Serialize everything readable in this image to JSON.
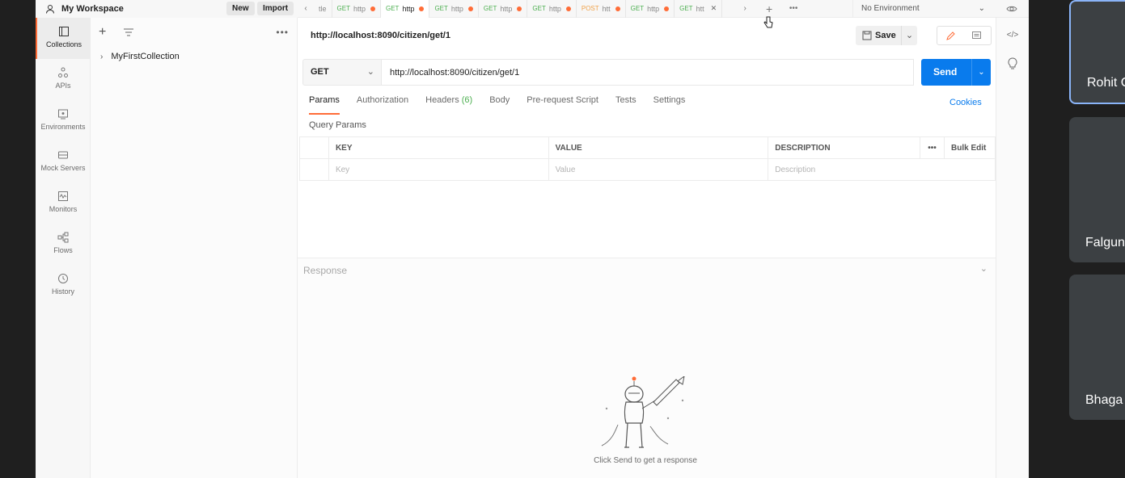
{
  "workspace": {
    "title": "My Workspace",
    "new_label": "New",
    "import_label": "Import"
  },
  "rail": [
    {
      "label": "Collections",
      "icon": "collections-icon"
    },
    {
      "label": "APIs",
      "icon": "apis-icon"
    },
    {
      "label": "Environments",
      "icon": "environments-icon"
    },
    {
      "label": "Mock Servers",
      "icon": "mock-servers-icon"
    },
    {
      "label": "Monitors",
      "icon": "monitors-icon"
    },
    {
      "label": "Flows",
      "icon": "flows-icon"
    },
    {
      "label": "History",
      "icon": "history-icon"
    }
  ],
  "sidebar": {
    "collection_name": "MyFirstCollection"
  },
  "tabs": [
    {
      "method": "",
      "label": "tle"
    },
    {
      "method": "GET",
      "label": "http"
    },
    {
      "method": "GET",
      "label": "http"
    },
    {
      "method": "GET",
      "label": "http"
    },
    {
      "method": "GET",
      "label": "http"
    },
    {
      "method": "GET",
      "label": "http"
    },
    {
      "method": "POST",
      "label": "htt"
    },
    {
      "method": "GET",
      "label": "http"
    },
    {
      "method": "GET",
      "label": "htt"
    }
  ],
  "environment": {
    "selected": "No Environment"
  },
  "request": {
    "name": "http://localhost:8090/citizen/get/1",
    "save_label": "Save",
    "method": "GET",
    "url": "http://localhost:8090/citizen/get/1",
    "send_label": "Send",
    "tabs": {
      "params": "Params",
      "authorization": "Authorization",
      "headers": "Headers",
      "headers_count": "(6)",
      "body": "Body",
      "prerequest": "Pre-request Script",
      "tests": "Tests",
      "settings": "Settings"
    },
    "cookies_label": "Cookies",
    "query_params_label": "Query Params",
    "table": {
      "key_header": "KEY",
      "value_header": "VALUE",
      "description_header": "DESCRIPTION",
      "bulk_edit": "Bulk Edit",
      "key_placeholder": "Key",
      "value_placeholder": "Value",
      "description_placeholder": "Description"
    }
  },
  "response": {
    "label": "Response",
    "hint": "Click Send to get a response"
  },
  "participants": [
    {
      "name": "Rohit C"
    },
    {
      "name": "Falguni"
    },
    {
      "name": "Bhaga"
    }
  ],
  "colors": {
    "accent": "#ff6c37",
    "send": "#097bed",
    "get_method": "#4caf50",
    "post_method": "#f0a24a"
  }
}
